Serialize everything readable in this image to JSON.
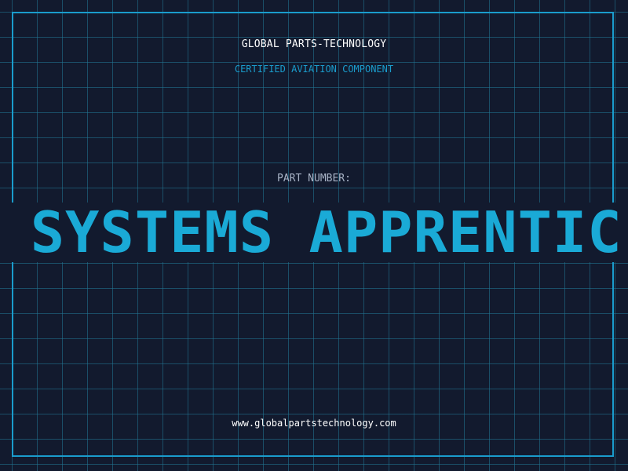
{
  "header": {
    "company": "GLOBAL PARTS-TECHNOLOGY",
    "subtitle": "CERTIFIED AVIATION COMPONENT"
  },
  "part": {
    "label": "PART NUMBER:",
    "value": "R SYSTEMS APPRENTIC"
  },
  "footer": {
    "website": "www.globalpartstechnology.com"
  },
  "colors": {
    "background": "#121a2e",
    "grid": "#227896",
    "accent": "#1aaad6",
    "text": "#ffffff",
    "muted": "#a8b3c6"
  }
}
